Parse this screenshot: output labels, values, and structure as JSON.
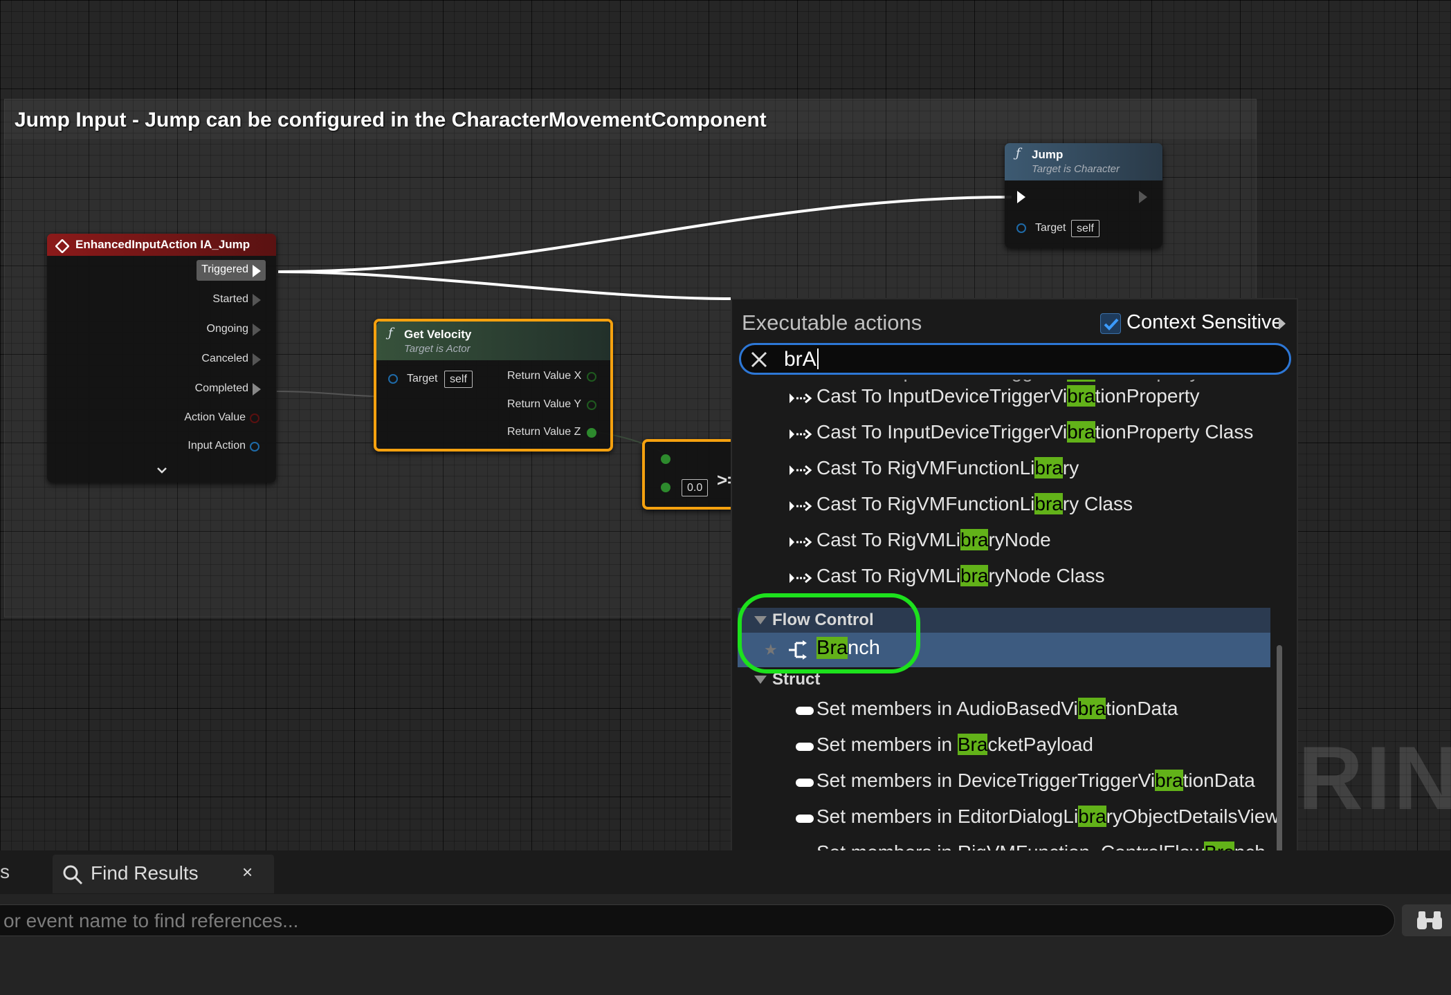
{
  "comment": {
    "title": "Jump Input - Jump can be configured in the CharacterMovementComponent"
  },
  "watermark": "RINT",
  "nodes": {
    "input_action": {
      "title": "EnhancedInputAction IA_Jump",
      "pins": [
        "Triggered",
        "Started",
        "Ongoing",
        "Canceled",
        "Completed",
        "Action Value",
        "Input Action"
      ]
    },
    "get_velocity": {
      "title": "Get Velocity",
      "subtitle": "Target is Actor",
      "target_label": "Target",
      "target_value": "self",
      "outputs": [
        "Return Value X",
        "Return Value Y",
        "Return Value Z"
      ]
    },
    "compare": {
      "value": "0.0",
      "op": ">="
    },
    "jump": {
      "title": "Jump",
      "subtitle": "Target is Character",
      "target_label": "Target",
      "target_value": "self"
    }
  },
  "menu": {
    "title": "Executable actions",
    "context_sensitive_label": "Context Sensitive",
    "context_sensitive_checked": true,
    "search_value": "brA",
    "cast_rows": [
      [
        "Cast To InputDeviceTriggerVi",
        "bra",
        "tionProperty"
      ],
      [
        "Cast To InputDeviceTriggerVi",
        "bra",
        "tionProperty Class"
      ],
      [
        "Cast To RigVMFunctionLi",
        "bra",
        "ry"
      ],
      [
        "Cast To RigVMFunctionLi",
        "bra",
        "ry Class"
      ],
      [
        "Cast To RigVMLi",
        "bra",
        "ryNode"
      ],
      [
        "Cast To RigVMLi",
        "bra",
        "ryNode Class"
      ]
    ],
    "flow_control_label": "Flow Control",
    "branch": {
      "hl": "Bra",
      "rest": "nch"
    },
    "struct_label": "Struct",
    "struct_rows": [
      [
        "Set members in AudioBasedVi",
        "bra",
        "tionData"
      ],
      [
        "Set members in ",
        "Bra",
        "cketPayload"
      ],
      [
        "Set members in DeviceTriggerTriggerVi",
        "bra",
        "tionData"
      ],
      [
        "Set members in EditorDialogLi",
        "bra",
        "ryObjectDetailsView("
      ],
      [
        "Set members in RigVMFunction_ControlFlow",
        "Bra",
        "nch"
      ]
    ]
  },
  "bottom": {
    "tab_partial": "s",
    "find_tab_label": "Find Results",
    "find_tab_close": "×",
    "find_placeholder": "or event name to find references..."
  },
  "icons": {
    "function": "function-icon",
    "event": "event-diamond-icon",
    "search_clear": "close-icon",
    "find": "magnifier-icon",
    "binoculars": "binoculars-icon",
    "branch": "branch-icon",
    "cast": "cast-arrow-icon",
    "struct": "struct-pill-icon",
    "favorite": "star-icon"
  },
  "colors": {
    "event_header": "#8b1a1a",
    "function_header_green": "#37523b",
    "function_header_blue": "#3d5a72",
    "selection_outline": "#f5a10f",
    "highlight": "#62b219",
    "selected_row": "#3d5b80",
    "search_border": "#2d77d6",
    "annotation_ring": "#1de11d"
  }
}
